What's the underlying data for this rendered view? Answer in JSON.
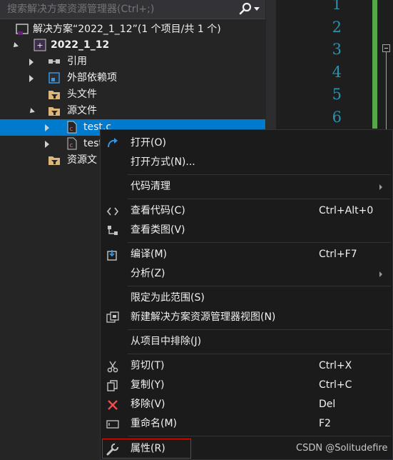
{
  "search": {
    "placeholder": "搜索解决方案资源管理器(Ctrl+;)"
  },
  "tree": {
    "solution_label": "解决方案“2022_1_12”(1 个项目/共 1 个)",
    "project_label": "2022_1_12",
    "references_label": "引用",
    "external_deps_label": "外部依赖项",
    "header_files_label": "头文件",
    "source_files_label": "源文件",
    "file1_label": "test.c",
    "file2_label": "test",
    "resource_files_label": "资源文"
  },
  "editor": {
    "line_numbers": [
      "1",
      "2",
      "3",
      "4",
      "5",
      "6"
    ]
  },
  "context_menu": {
    "open": "打开(O)",
    "open_with": "打开方式(N)...",
    "code_cleanup": "代码清理",
    "view_code": "查看代码(C)",
    "view_code_shortcut": "Ctrl+Alt+0",
    "view_class_diagram": "查看类图(V)",
    "compile": "编译(M)",
    "compile_shortcut": "Ctrl+F7",
    "analyze": "分析(Z)",
    "scope_to_this": "限定为此范围(S)",
    "new_explorer_view": "新建解决方案资源管理器视图(N)",
    "exclude_from_project": "从项目中排除(J)",
    "cut": "剪切(T)",
    "cut_shortcut": "Ctrl+X",
    "copy": "复制(Y)",
    "copy_shortcut": "Ctrl+C",
    "remove": "移除(V)",
    "remove_shortcut": "Del",
    "rename": "重命名(M)",
    "rename_shortcut": "F2",
    "properties": "属性(R)"
  },
  "watermark": "CSDN @Solitudefire",
  "colors": {
    "selection": "#007acc",
    "menu_background": "#1b1b1c",
    "highlight_border": "#e51400",
    "line_number": "#2b91af",
    "change_bar": "#57a64a"
  }
}
